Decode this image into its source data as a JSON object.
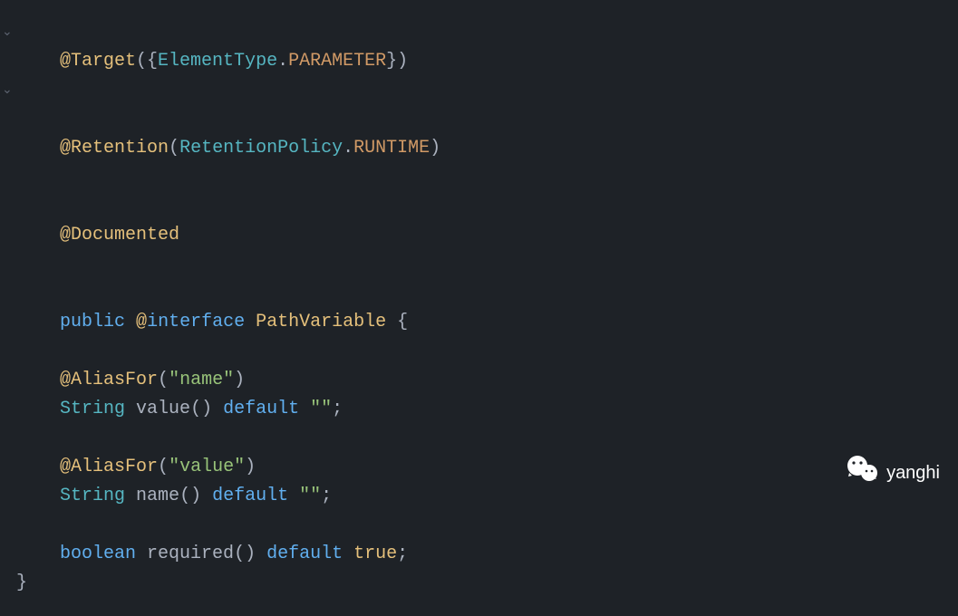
{
  "gutter": {
    "fold1": "⌄",
    "fold2": "⌄"
  },
  "code": {
    "line1": {
      "annotation": "@Target",
      "p1": "({",
      "type": "ElementType",
      "p2": ".",
      "const": "PARAMETER",
      "p3": "})"
    },
    "line2": {
      "annotation": "@Retention",
      "p1": "(",
      "type": "RetentionPolicy",
      "p2": ".",
      "const": "RUNTIME",
      "p3": ")"
    },
    "line3": {
      "annotation": "@Documented"
    },
    "line4": {
      "kw1": "public",
      "sp1": " ",
      "at": "@",
      "kw2": "interface",
      "sp2": " ",
      "classname": "PathVariable",
      "sp3": " ",
      "brace": "{"
    },
    "line5": {
      "indent": "    ",
      "annotation": "@AliasFor",
      "p1": "(",
      "string": "\"name\"",
      "p2": ")"
    },
    "line6": {
      "indent": "    ",
      "type": "String",
      "sp1": " ",
      "method": "value",
      "p1": "()",
      "sp2": " ",
      "kw": "default",
      "sp3": " ",
      "string": "\"\"",
      "semi": ";"
    },
    "line8": {
      "indent": "    ",
      "annotation": "@AliasFor",
      "p1": "(",
      "string": "\"value\"",
      "p2": ")"
    },
    "line9": {
      "indent": "    ",
      "type": "String",
      "sp1": " ",
      "method": "name",
      "p1": "()",
      "sp2": " ",
      "kw": "default",
      "sp3": " ",
      "string": "\"\"",
      "semi": ";"
    },
    "line11": {
      "indent": "    ",
      "type": "boolean",
      "sp1": " ",
      "method": "required",
      "p1": "()",
      "sp2": " ",
      "kw": "default",
      "sp3": " ",
      "bool": "true",
      "semi": ";"
    },
    "line12": {
      "brace": "}"
    }
  },
  "watermark": {
    "text": "yanghi"
  }
}
